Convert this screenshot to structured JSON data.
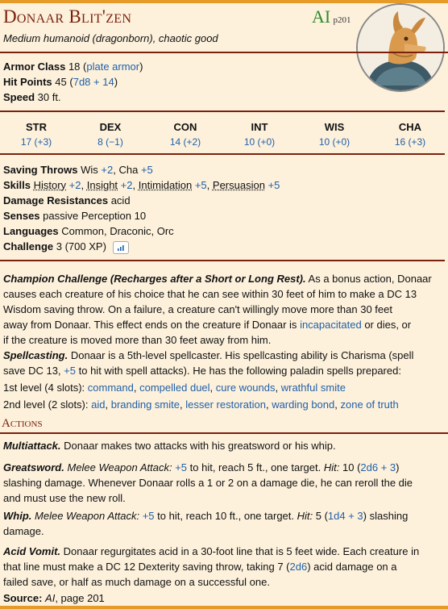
{
  "header": {
    "name": "Donaar Blit'zen",
    "source_abbr": "AI",
    "source_page": "p201",
    "type_line": "Medium humanoid (dragonborn), chaotic good"
  },
  "core": {
    "ac_label": "Armor Class",
    "ac_value": "18",
    "ac_armor": "plate armor",
    "hp_label": "Hit Points",
    "hp_value": "45",
    "hp_dice": "7d8 + 14",
    "speed_label": "Speed",
    "speed_value": "30 ft."
  },
  "abilities": [
    {
      "name": "STR",
      "score": "17 (+3)"
    },
    {
      "name": "DEX",
      "score": "8 (−1)"
    },
    {
      "name": "CON",
      "score": "14 (+2)"
    },
    {
      "name": "INT",
      "score": "10 (+0)"
    },
    {
      "name": "WIS",
      "score": "10 (+0)"
    },
    {
      "name": "CHA",
      "score": "16 (+3)"
    }
  ],
  "traits": {
    "saves_label": "Saving Throws",
    "saves_wis": "Wis",
    "saves_wis_mod": "+2",
    "saves_cha": "Cha",
    "saves_cha_mod": "+5",
    "skills_label": "Skills",
    "skill1": "History",
    "skill1_mod": "+2",
    "skill2": "Insight",
    "skill2_mod": "+2",
    "skill3": "Intimidation",
    "skill3_mod": "+5",
    "skill4": "Persuasion",
    "skill4_mod": "+5",
    "dr_label": "Damage Resistances",
    "dr_value": "acid",
    "senses_label": "Senses",
    "senses_value": "passive Perception 10",
    "lang_label": "Languages",
    "lang_value": "Common, Draconic, Orc",
    "cr_label": "Challenge",
    "cr_value": "3 (700 XP)"
  },
  "features": {
    "champion_title": "Champion Challenge (Recharges after a Short or Long Rest).",
    "champion_text1": "As a bonus action, Donaar",
    "champion_text2": "causes each creature of his choice that he can see within 30 feet of him to make a DC 13",
    "champion_text3": "Wisdom saving throw. On a failure, a creature can't willingly move more than 30 feet",
    "champion_text4": "away from Donaar. This effect ends on the creature if Donaar is",
    "champion_link": "incapacitated",
    "champion_text5": "or dies, or",
    "champion_text6": "if the creature is moved more than 30 feet away from him.",
    "spell_title": "Spellcasting.",
    "spell_text1": "Donaar is a 5th-level spellcaster. His spellcasting ability is Charisma (spell",
    "spell_text2a": "save DC 13,",
    "spell_mod": "+5",
    "spell_text2b": "to hit with spell attacks). He has the following paladin spells prepared:",
    "lvl1_label": "1st level (4 slots):",
    "lvl1_spells": [
      "command",
      "compelled duel",
      "cure wounds",
      "wrathful smite"
    ],
    "lvl2_label": "2nd level (2 slots):",
    "lvl2_spells": [
      "aid",
      "branding smite",
      "lesser restoration",
      "warding bond",
      "zone of truth"
    ]
  },
  "actions": {
    "heading": "Actions",
    "multi_title": "Multiattack.",
    "multi_text": "Donaar makes two attacks with his greatsword or his whip.",
    "gs_title": "Greatsword.",
    "gs_type": "Melee Weapon Attack:",
    "gs_mod": "+5",
    "gs_text1": "to hit, reach 5 ft., one target.",
    "gs_hit": "Hit:",
    "gs_dmg": "10 (",
    "gs_dice": "2d6 + 3",
    "gs_dmg_end": ")",
    "gs_text2": "slashing damage. Whenever Donaar rolls a 1 or 2 on a damage die, he can reroll the die",
    "gs_text3": "and must use the new roll.",
    "whip_title": "Whip.",
    "whip_type": "Melee Weapon Attack:",
    "whip_mod": "+5",
    "whip_text1": "to hit, reach 10 ft., one target.",
    "whip_hit": "Hit:",
    "whip_dmg": "5 (",
    "whip_dice": "1d4 + 3",
    "whip_text2": ") slashing",
    "whip_text3": "damage.",
    "acid_title": "Acid Vomit.",
    "acid_text1": "Donaar regurgitates acid in a 30-foot line that is 5 feet wide. Each creature in",
    "acid_text2a": "that line must make a DC 12 Dexterity saving throw, taking 7 (",
    "acid_dice": "2d6",
    "acid_text2b": ") acid damage on a",
    "acid_text3": "failed save, or half as much damage on a successful one."
  },
  "footer": {
    "source_label": "Source:",
    "source_book": "AI",
    "source_page": ", page 201"
  },
  "colors": {
    "accent": "#7A200D",
    "link": "#2160A8",
    "bar": "#E69A28",
    "background": "#FDF1DC"
  }
}
